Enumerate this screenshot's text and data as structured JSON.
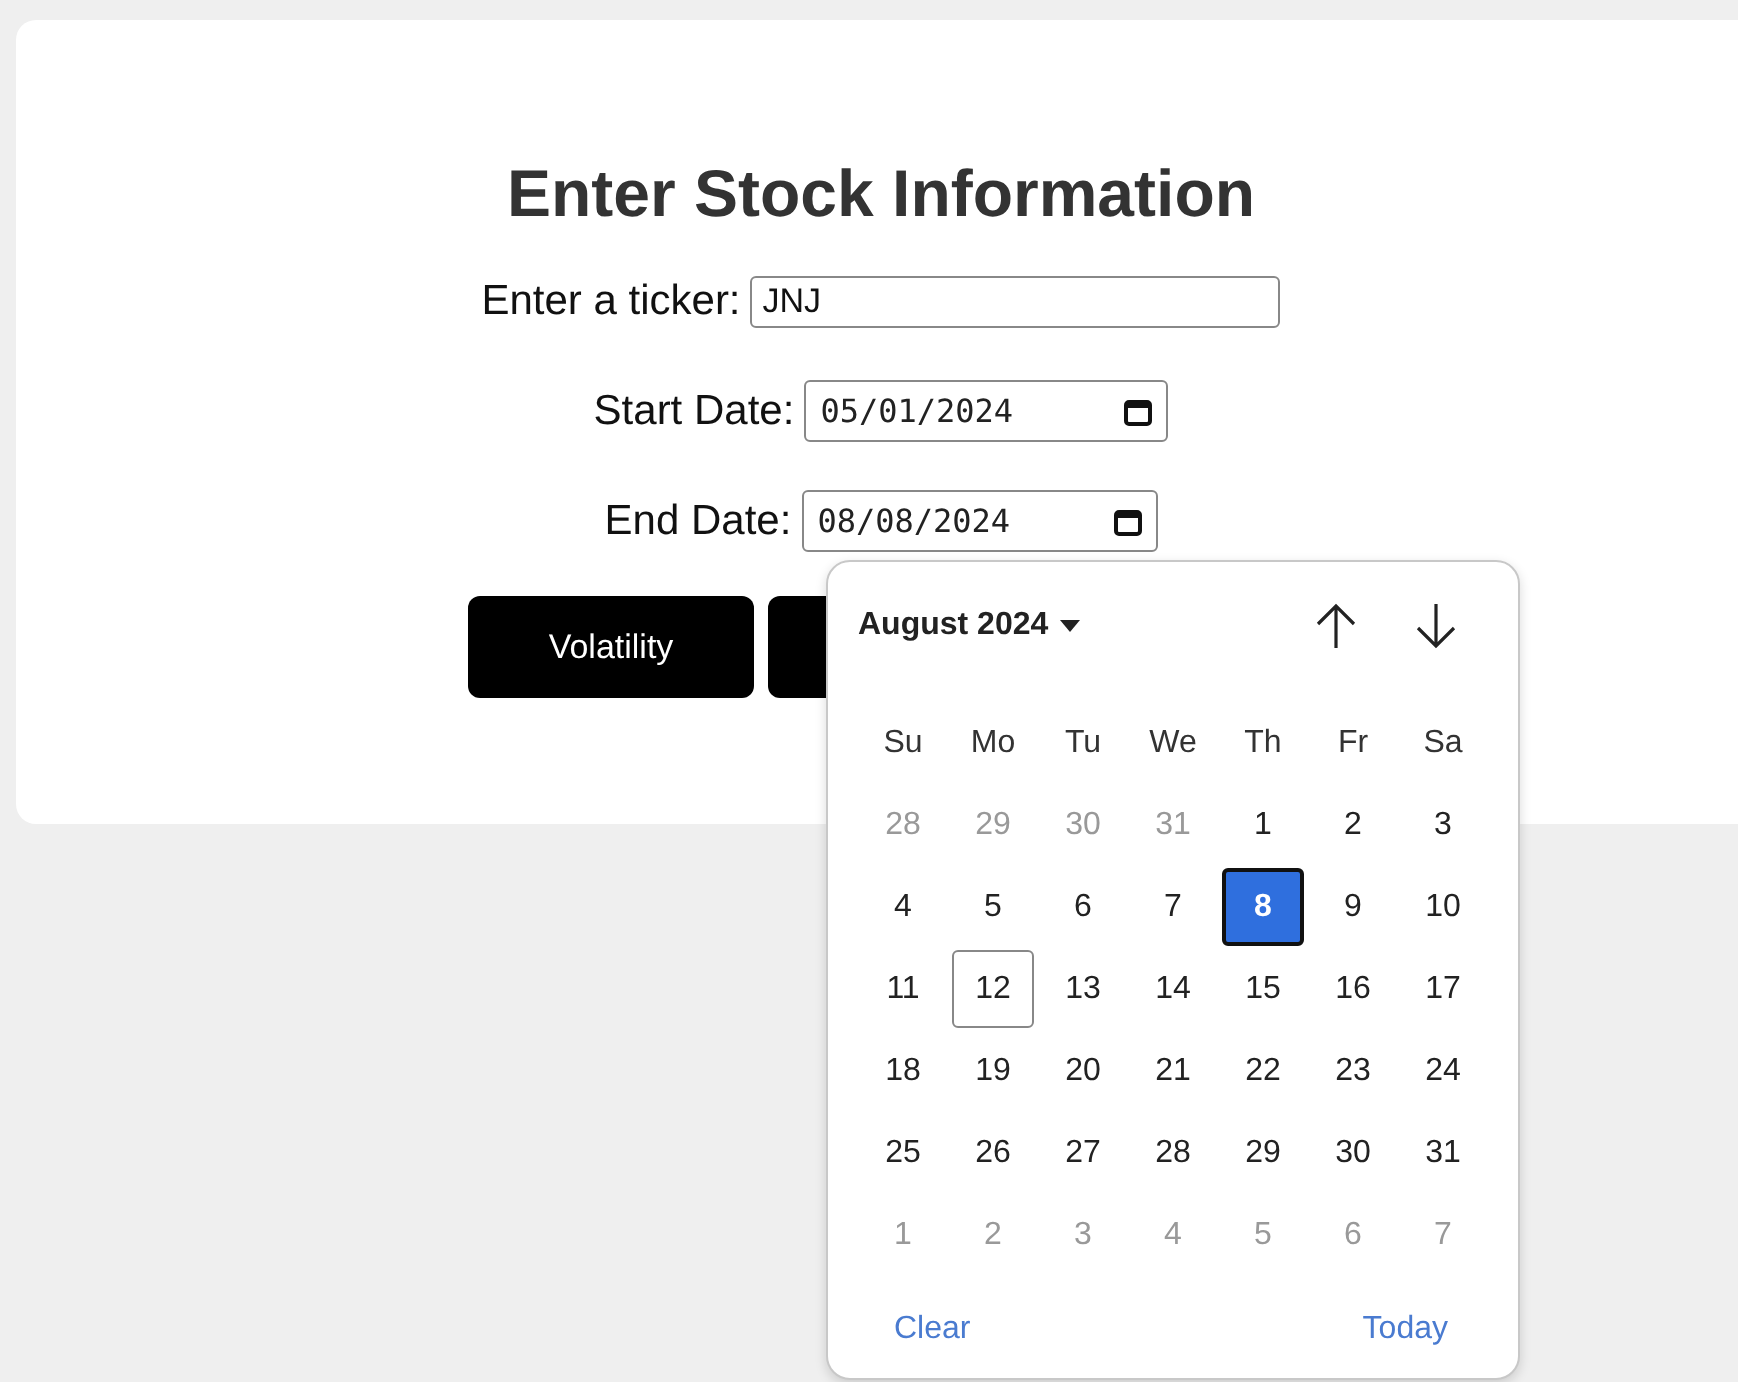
{
  "form": {
    "title": "Enter Stock Information",
    "fields": [
      {
        "label": "Enter a ticker:",
        "kind": "text",
        "value": "JNJ"
      },
      {
        "label": "Start Date:",
        "kind": "date",
        "value": "05/01/2024"
      },
      {
        "label": "End Date:",
        "kind": "date",
        "value": "08/08/2024"
      }
    ],
    "buttons": [
      {
        "kind": "labeled",
        "label": "Volatility"
      },
      {
        "kind": "covered"
      }
    ]
  },
  "calendar": {
    "month": "August 2024",
    "weekdays": [
      "Su",
      "Mo",
      "Tu",
      "We",
      "Th",
      "Fr",
      "Sa"
    ],
    "days": [
      {
        "label": "28",
        "outside": true,
        "selected": false,
        "today": false
      },
      {
        "label": "29",
        "outside": true,
        "selected": false,
        "today": false
      },
      {
        "label": "30",
        "outside": true,
        "selected": false,
        "today": false
      },
      {
        "label": "31",
        "outside": true,
        "selected": false,
        "today": false
      },
      {
        "label": "1",
        "outside": false,
        "selected": false,
        "today": false
      },
      {
        "label": "2",
        "outside": false,
        "selected": false,
        "today": false
      },
      {
        "label": "3",
        "outside": false,
        "selected": false,
        "today": false
      },
      {
        "label": "4",
        "outside": false,
        "selected": false,
        "today": false
      },
      {
        "label": "5",
        "outside": false,
        "selected": false,
        "today": false
      },
      {
        "label": "6",
        "outside": false,
        "selected": false,
        "today": false
      },
      {
        "label": "7",
        "outside": false,
        "selected": false,
        "today": false
      },
      {
        "label": "8",
        "outside": false,
        "selected": true,
        "today": false
      },
      {
        "label": "9",
        "outside": false,
        "selected": false,
        "today": false
      },
      {
        "label": "10",
        "outside": false,
        "selected": false,
        "today": false
      },
      {
        "label": "11",
        "outside": false,
        "selected": false,
        "today": false
      },
      {
        "label": "12",
        "outside": false,
        "selected": false,
        "today": true
      },
      {
        "label": "13",
        "outside": false,
        "selected": false,
        "today": false
      },
      {
        "label": "14",
        "outside": false,
        "selected": false,
        "today": false
      },
      {
        "label": "15",
        "outside": false,
        "selected": false,
        "today": false
      },
      {
        "label": "16",
        "outside": false,
        "selected": false,
        "today": false
      },
      {
        "label": "17",
        "outside": false,
        "selected": false,
        "today": false
      },
      {
        "label": "18",
        "outside": false,
        "selected": false,
        "today": false
      },
      {
        "label": "19",
        "outside": false,
        "selected": false,
        "today": false
      },
      {
        "label": "20",
        "outside": false,
        "selected": false,
        "today": false
      },
      {
        "label": "21",
        "outside": false,
        "selected": false,
        "today": false
      },
      {
        "label": "22",
        "outside": false,
        "selected": false,
        "today": false
      },
      {
        "label": "23",
        "outside": false,
        "selected": false,
        "today": false
      },
      {
        "label": "24",
        "outside": false,
        "selected": false,
        "today": false
      },
      {
        "label": "25",
        "outside": false,
        "selected": false,
        "today": false
      },
      {
        "label": "26",
        "outside": false,
        "selected": false,
        "today": false
      },
      {
        "label": "27",
        "outside": false,
        "selected": false,
        "today": false
      },
      {
        "label": "28",
        "outside": false,
        "selected": false,
        "today": false
      },
      {
        "label": "29",
        "outside": false,
        "selected": false,
        "today": false
      },
      {
        "label": "30",
        "outside": false,
        "selected": false,
        "today": false
      },
      {
        "label": "31",
        "outside": false,
        "selected": false,
        "today": false
      },
      {
        "label": "1",
        "outside": true,
        "selected": false,
        "today": false
      },
      {
        "label": "2",
        "outside": true,
        "selected": false,
        "today": false
      },
      {
        "label": "3",
        "outside": true,
        "selected": false,
        "today": false
      },
      {
        "label": "4",
        "outside": true,
        "selected": false,
        "today": false
      },
      {
        "label": "5",
        "outside": true,
        "selected": false,
        "today": false
      },
      {
        "label": "6",
        "outside": true,
        "selected": false,
        "today": false
      },
      {
        "label": "7",
        "outside": true,
        "selected": false,
        "today": false
      }
    ],
    "footer": [
      "Clear",
      "Today"
    ]
  }
}
